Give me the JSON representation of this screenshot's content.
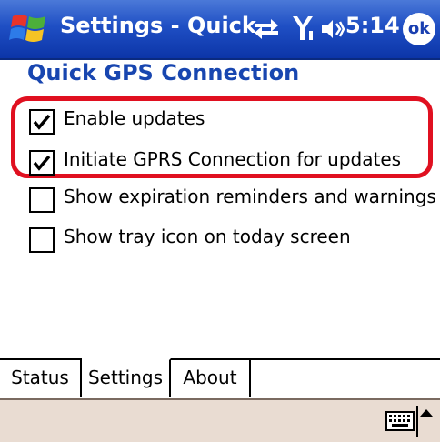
{
  "titlebar": {
    "title": "Settings - Quick",
    "time": "5:14",
    "ok_label": "ok"
  },
  "page": {
    "title": "Quick GPS Connection"
  },
  "options": [
    {
      "label": "Enable updates",
      "checked": true
    },
    {
      "label": "Initiate GPRS Connection for updates",
      "checked": true
    },
    {
      "label": "Show expiration reminders and warnings",
      "checked": false
    },
    {
      "label": "Show tray icon on today screen",
      "checked": false
    }
  ],
  "tabs": [
    {
      "label": "Status",
      "active": false
    },
    {
      "label": "Settings",
      "active": true
    },
    {
      "label": "About",
      "active": false
    }
  ],
  "icons": {
    "start": "windows-flag-icon",
    "connectivity": "sync-arrows-icon",
    "signal": "signal-icon",
    "volume": "speaker-icon",
    "keyboard": "keyboard-icon"
  },
  "colors": {
    "titlebar": "#1f4fc4",
    "heading": "#1846b0",
    "highlight": "#e01020",
    "cmdbar": "#e9dcd2"
  }
}
